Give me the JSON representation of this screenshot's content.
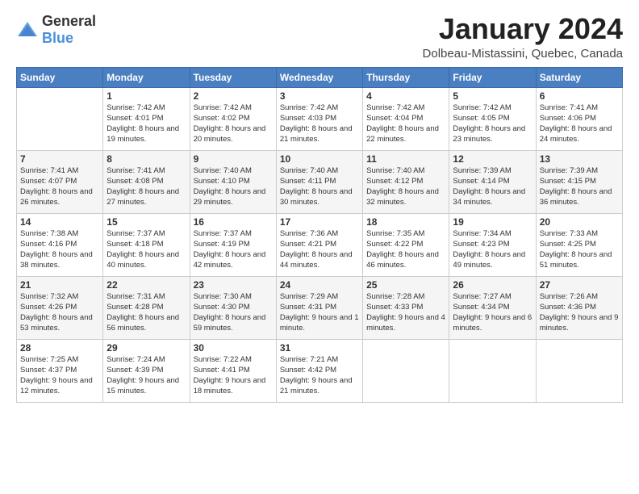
{
  "logo": {
    "general": "General",
    "blue": "Blue"
  },
  "header": {
    "month_year": "January 2024",
    "location": "Dolbeau-Mistassini, Quebec, Canada"
  },
  "weekdays": [
    "Sunday",
    "Monday",
    "Tuesday",
    "Wednesday",
    "Thursday",
    "Friday",
    "Saturday"
  ],
  "weeks": [
    [
      {
        "day": "",
        "sunrise": "",
        "sunset": "",
        "daylight": ""
      },
      {
        "day": "1",
        "sunrise": "Sunrise: 7:42 AM",
        "sunset": "Sunset: 4:01 PM",
        "daylight": "Daylight: 8 hours and 19 minutes."
      },
      {
        "day": "2",
        "sunrise": "Sunrise: 7:42 AM",
        "sunset": "Sunset: 4:02 PM",
        "daylight": "Daylight: 8 hours and 20 minutes."
      },
      {
        "day": "3",
        "sunrise": "Sunrise: 7:42 AM",
        "sunset": "Sunset: 4:03 PM",
        "daylight": "Daylight: 8 hours and 21 minutes."
      },
      {
        "day": "4",
        "sunrise": "Sunrise: 7:42 AM",
        "sunset": "Sunset: 4:04 PM",
        "daylight": "Daylight: 8 hours and 22 minutes."
      },
      {
        "day": "5",
        "sunrise": "Sunrise: 7:42 AM",
        "sunset": "Sunset: 4:05 PM",
        "daylight": "Daylight: 8 hours and 23 minutes."
      },
      {
        "day": "6",
        "sunrise": "Sunrise: 7:41 AM",
        "sunset": "Sunset: 4:06 PM",
        "daylight": "Daylight: 8 hours and 24 minutes."
      }
    ],
    [
      {
        "day": "7",
        "sunrise": "Sunrise: 7:41 AM",
        "sunset": "Sunset: 4:07 PM",
        "daylight": "Daylight: 8 hours and 26 minutes."
      },
      {
        "day": "8",
        "sunrise": "Sunrise: 7:41 AM",
        "sunset": "Sunset: 4:08 PM",
        "daylight": "Daylight: 8 hours and 27 minutes."
      },
      {
        "day": "9",
        "sunrise": "Sunrise: 7:40 AM",
        "sunset": "Sunset: 4:10 PM",
        "daylight": "Daylight: 8 hours and 29 minutes."
      },
      {
        "day": "10",
        "sunrise": "Sunrise: 7:40 AM",
        "sunset": "Sunset: 4:11 PM",
        "daylight": "Daylight: 8 hours and 30 minutes."
      },
      {
        "day": "11",
        "sunrise": "Sunrise: 7:40 AM",
        "sunset": "Sunset: 4:12 PM",
        "daylight": "Daylight: 8 hours and 32 minutes."
      },
      {
        "day": "12",
        "sunrise": "Sunrise: 7:39 AM",
        "sunset": "Sunset: 4:14 PM",
        "daylight": "Daylight: 8 hours and 34 minutes."
      },
      {
        "day": "13",
        "sunrise": "Sunrise: 7:39 AM",
        "sunset": "Sunset: 4:15 PM",
        "daylight": "Daylight: 8 hours and 36 minutes."
      }
    ],
    [
      {
        "day": "14",
        "sunrise": "Sunrise: 7:38 AM",
        "sunset": "Sunset: 4:16 PM",
        "daylight": "Daylight: 8 hours and 38 minutes."
      },
      {
        "day": "15",
        "sunrise": "Sunrise: 7:37 AM",
        "sunset": "Sunset: 4:18 PM",
        "daylight": "Daylight: 8 hours and 40 minutes."
      },
      {
        "day": "16",
        "sunrise": "Sunrise: 7:37 AM",
        "sunset": "Sunset: 4:19 PM",
        "daylight": "Daylight: 8 hours and 42 minutes."
      },
      {
        "day": "17",
        "sunrise": "Sunrise: 7:36 AM",
        "sunset": "Sunset: 4:21 PM",
        "daylight": "Daylight: 8 hours and 44 minutes."
      },
      {
        "day": "18",
        "sunrise": "Sunrise: 7:35 AM",
        "sunset": "Sunset: 4:22 PM",
        "daylight": "Daylight: 8 hours and 46 minutes."
      },
      {
        "day": "19",
        "sunrise": "Sunrise: 7:34 AM",
        "sunset": "Sunset: 4:23 PM",
        "daylight": "Daylight: 8 hours and 49 minutes."
      },
      {
        "day": "20",
        "sunrise": "Sunrise: 7:33 AM",
        "sunset": "Sunset: 4:25 PM",
        "daylight": "Daylight: 8 hours and 51 minutes."
      }
    ],
    [
      {
        "day": "21",
        "sunrise": "Sunrise: 7:32 AM",
        "sunset": "Sunset: 4:26 PM",
        "daylight": "Daylight: 8 hours and 53 minutes."
      },
      {
        "day": "22",
        "sunrise": "Sunrise: 7:31 AM",
        "sunset": "Sunset: 4:28 PM",
        "daylight": "Daylight: 8 hours and 56 minutes."
      },
      {
        "day": "23",
        "sunrise": "Sunrise: 7:30 AM",
        "sunset": "Sunset: 4:30 PM",
        "daylight": "Daylight: 8 hours and 59 minutes."
      },
      {
        "day": "24",
        "sunrise": "Sunrise: 7:29 AM",
        "sunset": "Sunset: 4:31 PM",
        "daylight": "Daylight: 9 hours and 1 minute."
      },
      {
        "day": "25",
        "sunrise": "Sunrise: 7:28 AM",
        "sunset": "Sunset: 4:33 PM",
        "daylight": "Daylight: 9 hours and 4 minutes."
      },
      {
        "day": "26",
        "sunrise": "Sunrise: 7:27 AM",
        "sunset": "Sunset: 4:34 PM",
        "daylight": "Daylight: 9 hours and 6 minutes."
      },
      {
        "day": "27",
        "sunrise": "Sunrise: 7:26 AM",
        "sunset": "Sunset: 4:36 PM",
        "daylight": "Daylight: 9 hours and 9 minutes."
      }
    ],
    [
      {
        "day": "28",
        "sunrise": "Sunrise: 7:25 AM",
        "sunset": "Sunset: 4:37 PM",
        "daylight": "Daylight: 9 hours and 12 minutes."
      },
      {
        "day": "29",
        "sunrise": "Sunrise: 7:24 AM",
        "sunset": "Sunset: 4:39 PM",
        "daylight": "Daylight: 9 hours and 15 minutes."
      },
      {
        "day": "30",
        "sunrise": "Sunrise: 7:22 AM",
        "sunset": "Sunset: 4:41 PM",
        "daylight": "Daylight: 9 hours and 18 minutes."
      },
      {
        "day": "31",
        "sunrise": "Sunrise: 7:21 AM",
        "sunset": "Sunset: 4:42 PM",
        "daylight": "Daylight: 9 hours and 21 minutes."
      },
      {
        "day": "",
        "sunrise": "",
        "sunset": "",
        "daylight": ""
      },
      {
        "day": "",
        "sunrise": "",
        "sunset": "",
        "daylight": ""
      },
      {
        "day": "",
        "sunrise": "",
        "sunset": "",
        "daylight": ""
      }
    ]
  ]
}
